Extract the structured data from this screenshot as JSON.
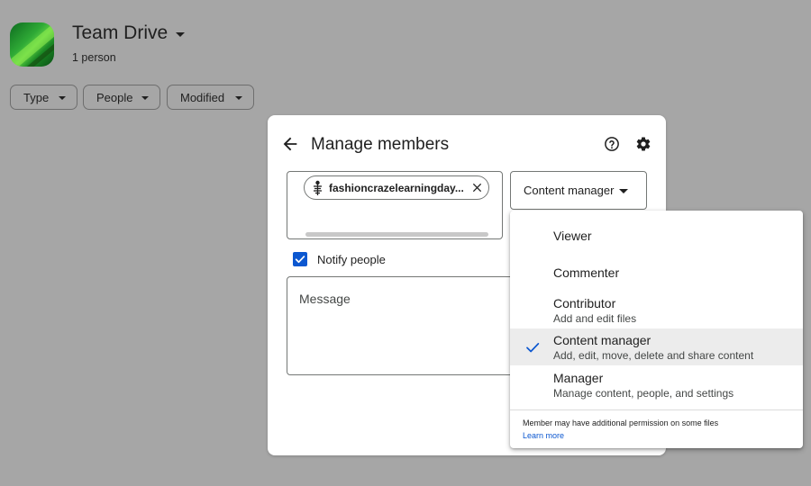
{
  "header": {
    "title": "Team Drive",
    "subtitle": "1 person"
  },
  "filters": [
    {
      "label": "Type"
    },
    {
      "label": "People"
    },
    {
      "label": "Modified"
    }
  ],
  "dialog": {
    "title": "Manage members",
    "recipient": {
      "label": "fashioncrazelearningday..."
    },
    "role_select": {
      "value": "Content manager"
    },
    "notify": {
      "label": "Notify people",
      "checked": true
    },
    "message": {
      "placeholder": "Message"
    }
  },
  "role_menu": {
    "items": [
      {
        "label": "Viewer",
        "description": "",
        "selected": false
      },
      {
        "label": "Commenter",
        "description": "",
        "selected": false
      },
      {
        "label": "Contributor",
        "description": "Add and edit files",
        "selected": false
      },
      {
        "label": "Content manager",
        "description": "Add, edit, move, delete and share content",
        "selected": true
      },
      {
        "label": "Manager",
        "description": "Manage content, people, and settings",
        "selected": false
      }
    ],
    "note": "Member may have additional permission on some files",
    "link": "Learn more"
  },
  "colors": {
    "backdrop": "#a6a6a6",
    "accent": "#0b57d0",
    "selected_row": "#ececec"
  },
  "icons": [
    "back-arrow-icon",
    "help-icon",
    "gear-icon",
    "close-icon",
    "check-icon",
    "checkbox-checked-icon",
    "chevron-down-icon"
  ]
}
